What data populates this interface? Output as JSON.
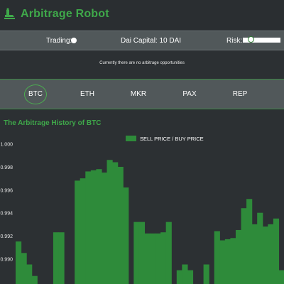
{
  "header": {
    "title": "Arbitrage Robot",
    "logo_icon": "robot-icon",
    "accent": "#3fa84a"
  },
  "controls": {
    "trading_label": "Trading:",
    "trading_on": true,
    "capital_text": "Dai Capital: 10 DAI",
    "risk_label": "Risk:",
    "risk_level": 0.2
  },
  "status": {
    "message": "Currently there are no arbitrage opportunities"
  },
  "coins": [
    {
      "label": "BTC",
      "active": true
    },
    {
      "label": "ETH",
      "active": false
    },
    {
      "label": "MKR",
      "active": false
    },
    {
      "label": "PAX",
      "active": false
    },
    {
      "label": "REP",
      "active": false
    }
  ],
  "history": {
    "title": "The Arbitrage History of BTC"
  },
  "chart_data": {
    "type": "area",
    "series": [
      {
        "name": "SELL PRICE / BUY PRICE",
        "color": "#2e8b3a",
        "values": [
          0.9915,
          0.9905,
          0.9895,
          0.9885,
          0.9877,
          0.9873,
          0.9877,
          0.9923,
          0.9923,
          0.9877,
          0.9876,
          0.9968,
          0.997,
          0.9976,
          0.9977,
          0.9978,
          0.9975,
          0.9986,
          0.9984,
          0.998,
          0.9962,
          0.9877,
          0.9932,
          0.9932,
          0.9922,
          0.9922,
          0.9922,
          0.9923,
          0.9932,
          0.9875,
          0.989,
          0.9895,
          0.989,
          0.9875,
          0.9878,
          0.9895,
          0.9873,
          0.9924,
          0.9916,
          0.9917,
          0.9918,
          0.9925,
          0.9944,
          0.9952,
          0.993,
          0.994,
          0.9928,
          0.993,
          0.9935,
          0.989
        ]
      }
    ],
    "ylim": [
      0.9878,
      1.0001
    ],
    "yticks": [
      "1.000",
      "0.998",
      "0.996",
      "0.994",
      "0.992",
      "0.990"
    ],
    "yvals": [
      1.0,
      0.998,
      0.996,
      0.994,
      0.992,
      0.99
    ],
    "legend_position": "top-center",
    "grid": false
  }
}
